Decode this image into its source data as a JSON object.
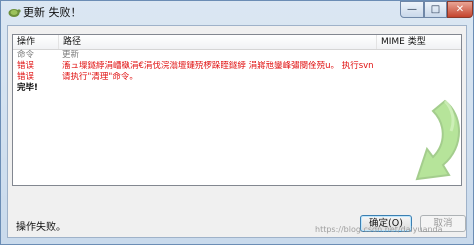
{
  "window": {
    "title": "更新 失败！"
  },
  "titlebar": {
    "minimize_glyph": "—",
    "maximize_glyph": "□",
    "close_glyph": "✕"
  },
  "table": {
    "columns": {
      "operation": "操作",
      "path": "路径",
      "mime": "MIME 类型"
    },
    "rows": [
      {
        "op": "命令",
        "path": "更新",
        "style": "gray"
      },
      {
        "op": "错误",
        "path": "滀ュ壈鐩綍涓嶆槸涓€涓伐浣滃壇鏈殑椤跺眰鐩綍    涓嶈兘鑾峰彇閿佺殑u。 执行svn cleanup然?",
        "style": "red"
      },
      {
        "op": "错误",
        "path": "请执行\"清理\"命令。",
        "style": "red"
      },
      {
        "op": "完毕!",
        "path": "",
        "style": "black"
      }
    ]
  },
  "status": {
    "text": "操作失败。",
    "icon": "green-update-arrow-icon"
  },
  "buttons": {
    "ok": "确定(O)",
    "cancel": "取消"
  },
  "watermark": "https://blog.csdn.net/daiyuanda",
  "colors": {
    "error": "#e01010",
    "command": "#7a7a7a",
    "arrow": "#5dbb33"
  }
}
